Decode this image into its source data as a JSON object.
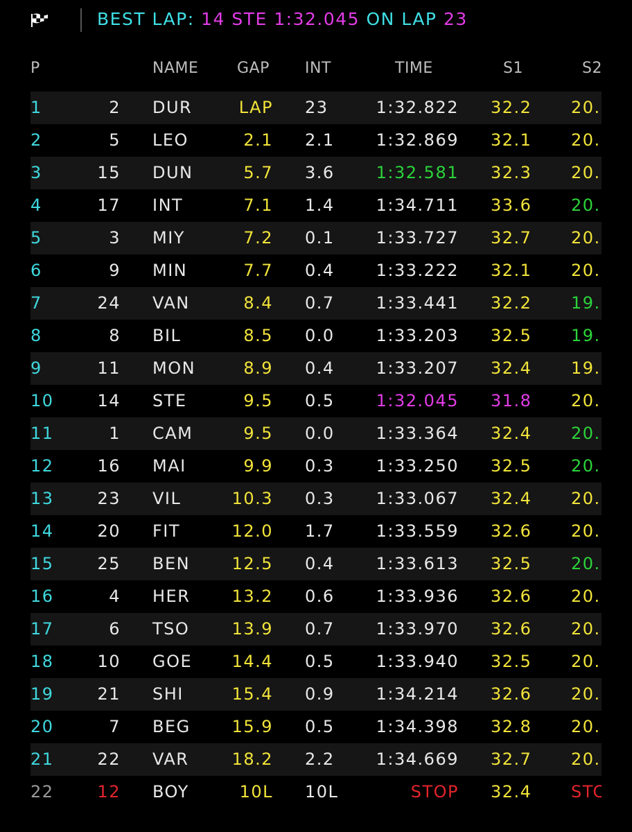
{
  "header": {
    "best_lap_label": "BEST LAP:",
    "best_lap_driver": "14 STE 1:32.045",
    "best_lap_on": "ON LAP",
    "best_lap_number": "23",
    "flag_icon": "checkered-flag-icon"
  },
  "columns": {
    "pos": "P",
    "name": "NAME",
    "gap": "GAP",
    "int": "INT",
    "time": "TIME",
    "s1": "S1",
    "s2": "S2"
  },
  "colors": {
    "cyan": "#3fe0e6",
    "magenta": "#e23ce6",
    "yellow": "#f1e33a",
    "green": "#2bd33a",
    "red": "#e3242b",
    "white": "#e8e8e8",
    "grey": "#9a9a9a"
  },
  "rows": [
    {
      "pos": "1",
      "num": "2",
      "name": "DUR",
      "gap": "LAP",
      "int": "23",
      "time": "1:32.822",
      "s1": "32.2",
      "s2": "20.",
      "gap_color": "yellow",
      "time_color": "white",
      "s1_color": "yellow",
      "s2_color": "yellow"
    },
    {
      "pos": "2",
      "num": "5",
      "name": "LEO",
      "gap": "2.1",
      "int": "2.1",
      "time": "1:32.869",
      "s1": "32.1",
      "s2": "20.",
      "gap_color": "yellow",
      "time_color": "white",
      "s1_color": "yellow",
      "s2_color": "yellow"
    },
    {
      "pos": "3",
      "num": "15",
      "name": "DUN",
      "gap": "5.7",
      "int": "3.6",
      "time": "1:32.581",
      "s1": "32.3",
      "s2": "20.",
      "gap_color": "yellow",
      "time_color": "green",
      "s1_color": "yellow",
      "s2_color": "yellow"
    },
    {
      "pos": "4",
      "num": "17",
      "name": "INT",
      "gap": "7.1",
      "int": "1.4",
      "time": "1:34.711",
      "s1": "33.6",
      "s2": "20.",
      "gap_color": "yellow",
      "time_color": "white",
      "s1_color": "yellow",
      "s2_color": "green"
    },
    {
      "pos": "5",
      "num": "3",
      "name": "MIY",
      "gap": "7.2",
      "int": "0.1",
      "time": "1:33.727",
      "s1": "32.7",
      "s2": "20.",
      "gap_color": "yellow",
      "time_color": "white",
      "s1_color": "yellow",
      "s2_color": "yellow"
    },
    {
      "pos": "6",
      "num": "9",
      "name": "MIN",
      "gap": "7.7",
      "int": "0.4",
      "time": "1:33.222",
      "s1": "32.1",
      "s2": "20.",
      "gap_color": "yellow",
      "time_color": "white",
      "s1_color": "yellow",
      "s2_color": "yellow"
    },
    {
      "pos": "7",
      "num": "24",
      "name": "VAN",
      "gap": "8.4",
      "int": "0.7",
      "time": "1:33.441",
      "s1": "32.2",
      "s2": "19.",
      "gap_color": "yellow",
      "time_color": "white",
      "s1_color": "yellow",
      "s2_color": "green"
    },
    {
      "pos": "8",
      "num": "8",
      "name": "BIL",
      "gap": "8.5",
      "int": "0.0",
      "time": "1:33.203",
      "s1": "32.5",
      "s2": "19.",
      "gap_color": "yellow",
      "time_color": "white",
      "s1_color": "yellow",
      "s2_color": "green"
    },
    {
      "pos": "9",
      "num": "11",
      "name": "MON",
      "gap": "8.9",
      "int": "0.4",
      "time": "1:33.207",
      "s1": "32.4",
      "s2": "19.",
      "gap_color": "yellow",
      "time_color": "white",
      "s1_color": "yellow",
      "s2_color": "yellow"
    },
    {
      "pos": "10",
      "num": "14",
      "name": "STE",
      "gap": "9.5",
      "int": "0.5",
      "time": "1:32.045",
      "s1": "31.8",
      "s2": "20.",
      "gap_color": "yellow",
      "time_color": "magenta",
      "s1_color": "magenta",
      "s2_color": "yellow"
    },
    {
      "pos": "11",
      "num": "1",
      "name": "CAM",
      "gap": "9.5",
      "int": "0.0",
      "time": "1:33.364",
      "s1": "32.4",
      "s2": "20.",
      "gap_color": "yellow",
      "time_color": "white",
      "s1_color": "yellow",
      "s2_color": "green"
    },
    {
      "pos": "12",
      "num": "16",
      "name": "MAI",
      "gap": "9.9",
      "int": "0.3",
      "time": "1:33.250",
      "s1": "32.5",
      "s2": "20.",
      "gap_color": "yellow",
      "time_color": "white",
      "s1_color": "yellow",
      "s2_color": "green"
    },
    {
      "pos": "13",
      "num": "23",
      "name": "VIL",
      "gap": "10.3",
      "int": "0.3",
      "time": "1:33.067",
      "s1": "32.4",
      "s2": "20.",
      "gap_color": "yellow",
      "time_color": "white",
      "s1_color": "yellow",
      "s2_color": "yellow"
    },
    {
      "pos": "14",
      "num": "20",
      "name": "FIT",
      "gap": "12.0",
      "int": "1.7",
      "time": "1:33.559",
      "s1": "32.6",
      "s2": "20.",
      "gap_color": "yellow",
      "time_color": "white",
      "s1_color": "yellow",
      "s2_color": "yellow"
    },
    {
      "pos": "15",
      "num": "25",
      "name": "BEN",
      "gap": "12.5",
      "int": "0.4",
      "time": "1:33.613",
      "s1": "32.5",
      "s2": "20.",
      "gap_color": "yellow",
      "time_color": "white",
      "s1_color": "yellow",
      "s2_color": "green"
    },
    {
      "pos": "16",
      "num": "4",
      "name": "HER",
      "gap": "13.2",
      "int": "0.6",
      "time": "1:33.936",
      "s1": "32.6",
      "s2": "20.",
      "gap_color": "yellow",
      "time_color": "white",
      "s1_color": "yellow",
      "s2_color": "yellow"
    },
    {
      "pos": "17",
      "num": "6",
      "name": "TSO",
      "gap": "13.9",
      "int": "0.7",
      "time": "1:33.970",
      "s1": "32.6",
      "s2": "20.",
      "gap_color": "yellow",
      "time_color": "white",
      "s1_color": "yellow",
      "s2_color": "yellow"
    },
    {
      "pos": "18",
      "num": "10",
      "name": "GOE",
      "gap": "14.4",
      "int": "0.5",
      "time": "1:33.940",
      "s1": "32.5",
      "s2": "20.",
      "gap_color": "yellow",
      "time_color": "white",
      "s1_color": "yellow",
      "s2_color": "yellow"
    },
    {
      "pos": "19",
      "num": "21",
      "name": "SHI",
      "gap": "15.4",
      "int": "0.9",
      "time": "1:34.214",
      "s1": "32.6",
      "s2": "20.",
      "gap_color": "yellow",
      "time_color": "white",
      "s1_color": "yellow",
      "s2_color": "yellow"
    },
    {
      "pos": "20",
      "num": "7",
      "name": "BEG",
      "gap": "15.9",
      "int": "0.5",
      "time": "1:34.398",
      "s1": "32.8",
      "s2": "20.",
      "gap_color": "yellow",
      "time_color": "white",
      "s1_color": "yellow",
      "s2_color": "yellow"
    },
    {
      "pos": "21",
      "num": "22",
      "name": "VAR",
      "gap": "18.2",
      "int": "2.2",
      "time": "1:34.669",
      "s1": "32.7",
      "s2": "20.",
      "gap_color": "yellow",
      "time_color": "white",
      "s1_color": "yellow",
      "s2_color": "yellow"
    },
    {
      "pos": "22",
      "num": "12",
      "name": "BOY",
      "gap": "10L",
      "int": "10L",
      "time": "STOP",
      "s1": "32.4",
      "s2": "STC",
      "gap_color": "yellow",
      "time_color": "red",
      "s1_color": "yellow",
      "s2_color": "red",
      "pos_color": "grey",
      "num_color": "red"
    }
  ]
}
